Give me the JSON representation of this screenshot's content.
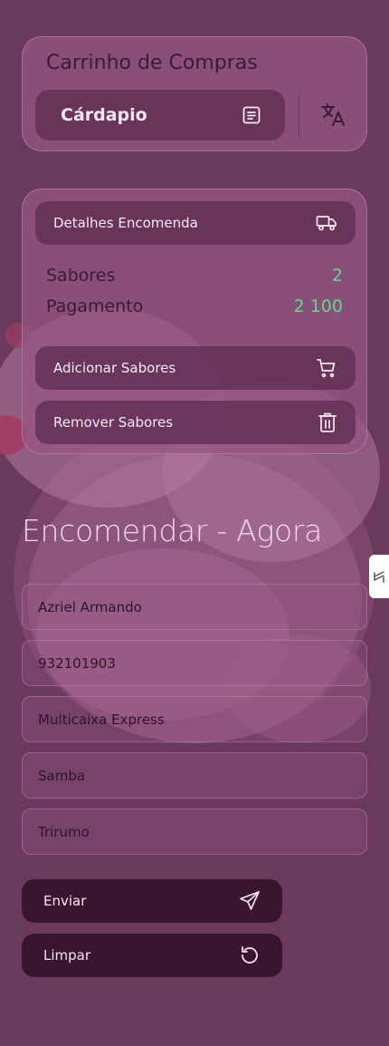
{
  "cart": {
    "title": "Carrinho de Compras",
    "menu_label": "Cárdapio"
  },
  "order_details": {
    "header_label": "Detalhes Encomenda",
    "flavors_label": "Sabores",
    "flavors_value": "2",
    "payment_label": "Pagamento",
    "payment_value": "2 100",
    "add_label": "Adicionar Sabores",
    "remove_label": "Remover Sabores"
  },
  "form": {
    "heading": "Encomendar - Agora",
    "name": "Azriel Armando",
    "phone": "932101903",
    "payment_method": "Multicaixa Express",
    "district": "Samba",
    "neighborhood": "Trirumo",
    "submit_label": "Enviar",
    "clear_label": "Limpar"
  },
  "colors": {
    "background": "#6a3a5e",
    "card": "#965684",
    "accent_green": "#6cd58a",
    "dark_button": "#3a1530"
  },
  "icons": [
    "list-icon",
    "translate-icon",
    "truck-icon",
    "cart-icon",
    "trash-icon",
    "send-icon",
    "reset-icon",
    "expand-icon"
  ]
}
